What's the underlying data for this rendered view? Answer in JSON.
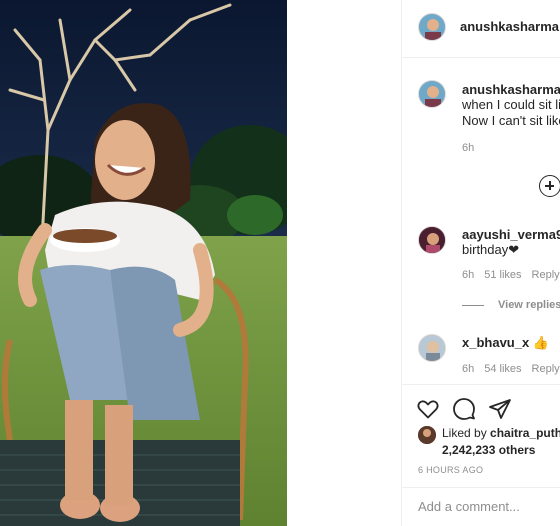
{
  "post": {
    "author": "anushkasharma",
    "verified": true
  },
  "caption": {
    "username": "anushkasharma",
    "line1": "when I could sit lik",
    "line2": "Now I can't sit like",
    "time": "6h"
  },
  "comments": [
    {
      "username": "aayushi_verma9k",
      "text": "birthday❤",
      "time": "6h",
      "likes": "51 likes",
      "reply": "Reply",
      "view_replies": "View replies ("
    },
    {
      "username": "x_bhavu_x",
      "text_suffix": "👍",
      "time": "6h",
      "likes": "54 likes",
      "reply": "Reply"
    }
  ],
  "actions": {
    "like_icon": "heart-icon",
    "comment_icon": "comment-icon",
    "share_icon": "share-icon"
  },
  "likes": {
    "liked_by_prefix": "Liked by",
    "liked_by_user": "chaitra_puth",
    "count": "2,242,233 others"
  },
  "timestamp": "6 HOURS AGO",
  "comment_box": {
    "placeholder": "Add a comment..."
  },
  "colors": {
    "accent": "#3897f0",
    "muted": "#8e8e8e",
    "text": "#262626"
  }
}
